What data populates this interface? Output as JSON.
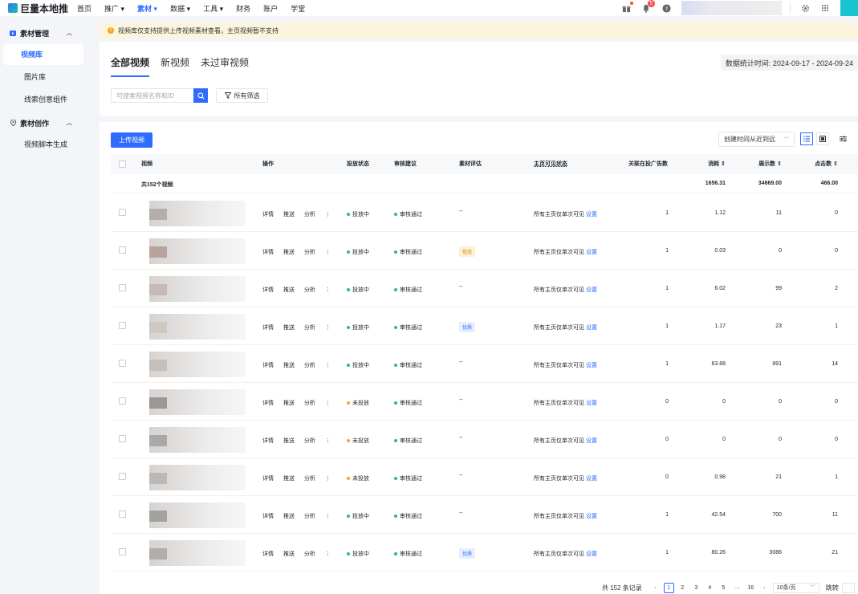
{
  "topbar": {
    "logo": "巨量本地推",
    "nav": [
      {
        "label": "首页",
        "active": false
      },
      {
        "label": "推广 ▾",
        "active": false
      },
      {
        "label": "素材 ▾",
        "active": true
      },
      {
        "label": "数据 ▾",
        "active": false
      },
      {
        "label": "工具 ▾",
        "active": false
      },
      {
        "label": "财务",
        "active": false
      },
      {
        "label": "账户",
        "active": false
      },
      {
        "label": "学堂",
        "active": false
      }
    ],
    "notification_count": "5"
  },
  "sidebar": {
    "group1": "素材管理",
    "items1": [
      "视频库",
      "图片库",
      "线索创意组件"
    ],
    "group2": "素材创作",
    "items2": [
      "视频脚本生成"
    ]
  },
  "notice": "视频库仅支持提供上传视频素材查看，主页视频暂不支持",
  "tabs": [
    "全部视频",
    "新视频",
    "未过审视频"
  ],
  "date_range": "数据统计时间:  2024-09-17  - 2024-09-24",
  "search": {
    "placeholder": "可搜索视频名称和ID"
  },
  "filter_label": "所有筛选",
  "upload_label": "上传视频",
  "sort_label": "创建时间从近到远",
  "columns": {
    "video": "视频",
    "ops": "操作",
    "status": "投放状态",
    "review": "审核建议",
    "rating": "素材评估",
    "visibility": "主页可见状态",
    "linked": "关联在投广告数",
    "cost": "消耗 ⇕",
    "impressions": "展示数 ⇕",
    "clicks": "点击数 ⇕"
  },
  "summary": {
    "label": "共152个视频",
    "cost": "1656.31",
    "impressions": "34669.00",
    "clicks": "466.00"
  },
  "op_labels": [
    "详情",
    "推送",
    "分析",
    "⋮"
  ],
  "set_label": "设置",
  "status_colors": {
    "active": "#1ec27a",
    "inactive": "#f5a623",
    "review": "#1ec27a"
  },
  "rows": [
    {
      "status": "投放中",
      "status_key": "active",
      "review": "审核通过",
      "rating": "--",
      "rating_key": "none",
      "visibility": "所有主页仅单次可见",
      "linked": "1",
      "cost": "1.12",
      "impressions": "11",
      "clicks": "0",
      "thumb_color": "#b5adab"
    },
    {
      "status": "投放中",
      "status_key": "active",
      "review": "审核通过",
      "rating": "低效",
      "rating_key": "low",
      "visibility": "所有主页仅单次可见",
      "linked": "1",
      "cost": "0.03",
      "impressions": "0",
      "clicks": "0",
      "thumb_color": "#b8a39f"
    },
    {
      "status": "投放中",
      "status_key": "active",
      "review": "审核通过",
      "rating": "--",
      "rating_key": "none",
      "visibility": "所有主页仅单次可见",
      "linked": "1",
      "cost": "6.02",
      "impressions": "99",
      "clicks": "2",
      "thumb_color": "#c7b9b6"
    },
    {
      "status": "投放中",
      "status_key": "active",
      "review": "审核通过",
      "rating": "优质",
      "rating_key": "good",
      "visibility": "所有主页仅单次可见",
      "linked": "1",
      "cost": "1.17",
      "impressions": "23",
      "clicks": "1",
      "thumb_color": "#cfc7c2"
    },
    {
      "status": "投放中",
      "status_key": "active",
      "review": "审核通过",
      "rating": "--",
      "rating_key": "none",
      "visibility": "所有主页仅单次可见",
      "linked": "1",
      "cost": "63.88",
      "impressions": "891",
      "clicks": "14",
      "thumb_color": "#c5beb9"
    },
    {
      "status": "未投放",
      "status_key": "inactive",
      "review": "审核通过",
      "rating": "--",
      "rating_key": "none",
      "visibility": "所有主页仅单次可见",
      "linked": "0",
      "cost": "0",
      "impressions": "0",
      "clicks": "0",
      "thumb_color": "#9a9795"
    },
    {
      "status": "未投放",
      "status_key": "inactive",
      "review": "审核通过",
      "rating": "--",
      "rating_key": "none",
      "visibility": "所有主页仅单次可见",
      "linked": "0",
      "cost": "0",
      "impressions": "0",
      "clicks": "0",
      "thumb_color": "#a9a9a9"
    },
    {
      "status": "未投放",
      "status_key": "inactive",
      "review": "审核通过",
      "rating": "--",
      "rating_key": "none",
      "visibility": "所有主页仅单次可见",
      "linked": "0",
      "cost": "0.98",
      "impressions": "21",
      "clicks": "1",
      "thumb_color": "#bcb8b5"
    },
    {
      "status": "投放中",
      "status_key": "active",
      "review": "审核通过",
      "rating": "--",
      "rating_key": "none",
      "visibility": "所有主页仅单次可见",
      "linked": "1",
      "cost": "42.54",
      "impressions": "700",
      "clicks": "11",
      "thumb_color": "#a4a2a1"
    },
    {
      "status": "投放中",
      "status_key": "active",
      "review": "审核通过",
      "rating": "优质",
      "rating_key": "good",
      "visibility": "所有主页仅单次可见",
      "linked": "1",
      "cost": "80.26",
      "impressions": "3086",
      "clicks": "21",
      "thumb_color": "#b0adab"
    }
  ],
  "pagination": {
    "total": "共 152 条记录",
    "pages": [
      "1",
      "2",
      "3",
      "4",
      "5",
      "···",
      "16"
    ],
    "current": "1",
    "per_page": "10条/页",
    "jump": "跳转"
  }
}
